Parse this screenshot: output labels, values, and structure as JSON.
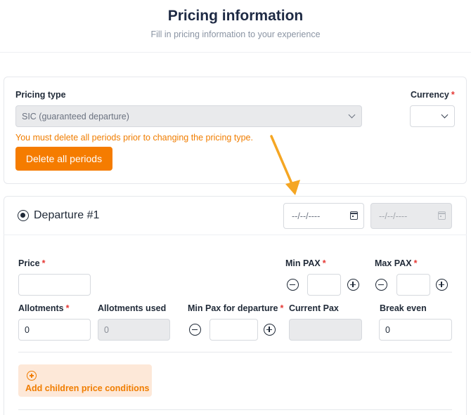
{
  "header": {
    "title": "Pricing information",
    "subtitle": "Fill in pricing information to your experience"
  },
  "pricing": {
    "type_label": "Pricing type",
    "type_value": "SIC (guaranteed departure)",
    "currency_label": "Currency",
    "currency_value": "",
    "warning": "You must delete all periods prior to changing the pricing type.",
    "delete_button": "Delete all periods"
  },
  "departure": {
    "title": "Departure #1",
    "start_date_placeholder": "--/--/----",
    "end_date_placeholder": "--/--/----",
    "price_label": "Price",
    "price_value": "",
    "min_pax_label": "Min PAX",
    "min_pax_value": "",
    "max_pax_label": "Max PAX",
    "max_pax_value": "",
    "allotments_label": "Allotments",
    "allotments_value": "0",
    "allotments_used_label": "Allotments used",
    "allotments_used_value": "0",
    "min_pax_departure_label": "Min Pax for departure",
    "min_pax_departure_value": "",
    "current_pax_label": "Current Pax",
    "current_pax_value": "",
    "break_even_label": "Break even",
    "break_even_value": "0",
    "add_children_label": "Add children price conditions"
  },
  "required_marker": "*",
  "colors": {
    "accent": "#f57c00",
    "warning_text": "#f07d00",
    "required": "#e53935",
    "annotation_arrow": "#f5a623"
  }
}
